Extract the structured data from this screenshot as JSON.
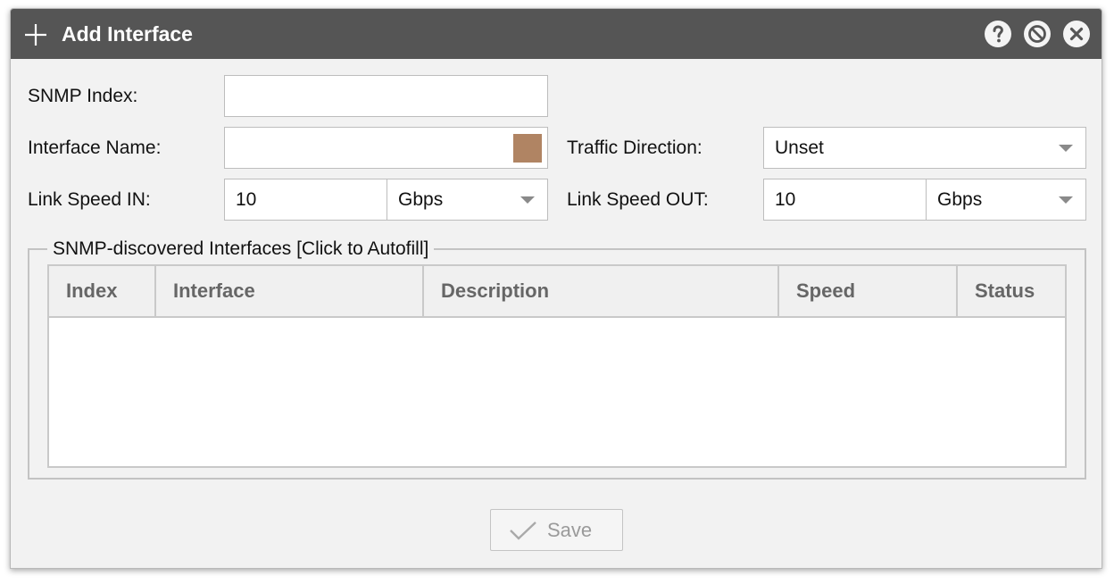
{
  "dialog": {
    "title": "Add Interface",
    "title_icon": "plus-icon",
    "controls": [
      "help-icon",
      "minimize-icon",
      "close-icon"
    ]
  },
  "form": {
    "snmp_index_label": "SNMP Index:",
    "snmp_index_value": "",
    "interface_name_label": "Interface Name:",
    "interface_name_value": "",
    "interface_color": "#b08463",
    "traffic_direction_label": "Traffic Direction:",
    "traffic_direction_value": "Unset",
    "link_speed_in_label": "Link Speed IN:",
    "link_speed_in_value": "10",
    "link_speed_in_unit": "Gbps",
    "link_speed_out_label": "Link Speed OUT:",
    "link_speed_out_value": "10",
    "link_speed_out_unit": "Gbps"
  },
  "discovered": {
    "legend": "SNMP-discovered Interfaces [Click to Autofill]",
    "columns": [
      "Index",
      "Interface",
      "Description",
      "Speed",
      "Status"
    ],
    "rows": []
  },
  "footer": {
    "save_label": "Save",
    "save_icon": "checkmark-icon"
  },
  "colors": {
    "titlebar": "#555555",
    "body": "#f2f2f2",
    "swatch": "#b08463"
  }
}
